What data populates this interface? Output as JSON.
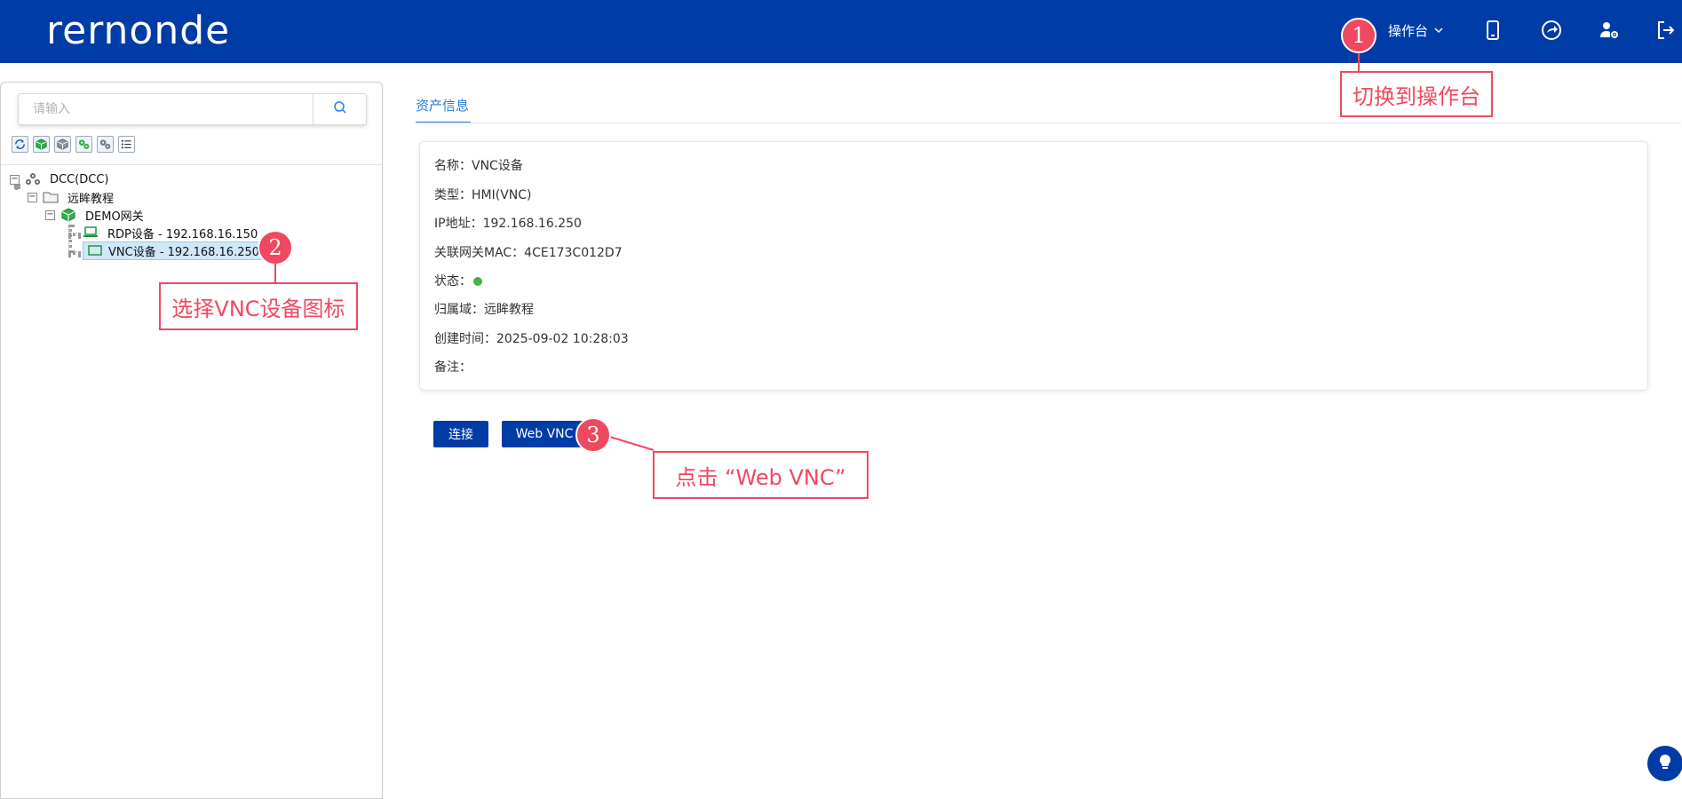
{
  "header": {
    "logo_text": "rernonde",
    "menu_label": "操作台",
    "icons": [
      "mobile-icon",
      "share-icon",
      "user-settings-icon",
      "logout-icon"
    ]
  },
  "annotations": {
    "badge1": "1",
    "callout1": "切换到操作台",
    "badge2": "2",
    "callout2": "选择VNC设备图标",
    "badge3": "3",
    "callout3": "点击 “Web VNC”"
  },
  "sidebar": {
    "search_placeholder": "请输入",
    "tree": {
      "root": "DCC(DCC)",
      "folder": "远眸教程",
      "gateway": "DEMO网关",
      "device1": "RDP设备 - 192.168.16.150",
      "device2": "VNC设备 - 192.168.16.250"
    }
  },
  "main": {
    "tab_label": "资产信息",
    "info": {
      "name": "名称：VNC设备",
      "type": "类型：HMI(VNC)",
      "ip": "IP地址：192.168.16.250",
      "mac": "关联网关MAC：4CE173C012D7",
      "status_label": "状态：",
      "domain": "归属域：远眸教程",
      "created": "创建时间：2025-09-02 10:28:03",
      "remark": "备注："
    },
    "status_color": "#42b542",
    "connect_label": "连接",
    "webvnc_label": "Web VNC"
  },
  "colors": {
    "brand": "#003ca6",
    "annotation": "#f0485e",
    "tab_active": "#2a7ce0"
  }
}
